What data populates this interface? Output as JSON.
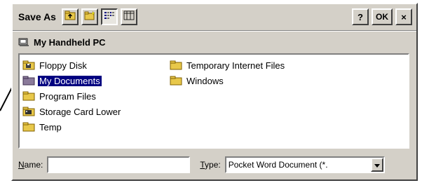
{
  "dialog": {
    "title": "Save As",
    "toolbar": {
      "up_folder_icon": "up-folder-icon",
      "new_folder_icon": "new-folder-icon",
      "list_view_icon": "list-view-icon",
      "details_view_icon": "details-view-icon"
    },
    "help_label": "?",
    "ok_label": "OK",
    "close_label": "×"
  },
  "location": {
    "label": "My Handheld PC"
  },
  "files": {
    "column1": [
      {
        "label": "Floppy Disk",
        "icon": "floppy-folder-icon",
        "selected": false
      },
      {
        "label": "My Documents",
        "icon": "folder-icon",
        "selected": true
      },
      {
        "label": "Program Files",
        "icon": "folder-icon",
        "selected": false
      },
      {
        "label": "Storage Card Lower",
        "icon": "storage-card-folder-icon",
        "selected": false
      },
      {
        "label": "Temp",
        "icon": "folder-icon",
        "selected": false
      }
    ],
    "column2": [
      {
        "label": "Temporary Internet Files",
        "icon": "folder-icon",
        "selected": false
      },
      {
        "label": "Windows",
        "icon": "folder-icon",
        "selected": false
      }
    ]
  },
  "name_field": {
    "label_underlined": "N",
    "label_rest": "ame:",
    "value": ""
  },
  "type_field": {
    "label_underlined": "T",
    "label_rest": "ype:",
    "value": "Pocket Word Document (*."
  },
  "colors": {
    "dialog_bg": "#d4d0c8",
    "selection": "#000080",
    "folder": "#e8c84a"
  }
}
